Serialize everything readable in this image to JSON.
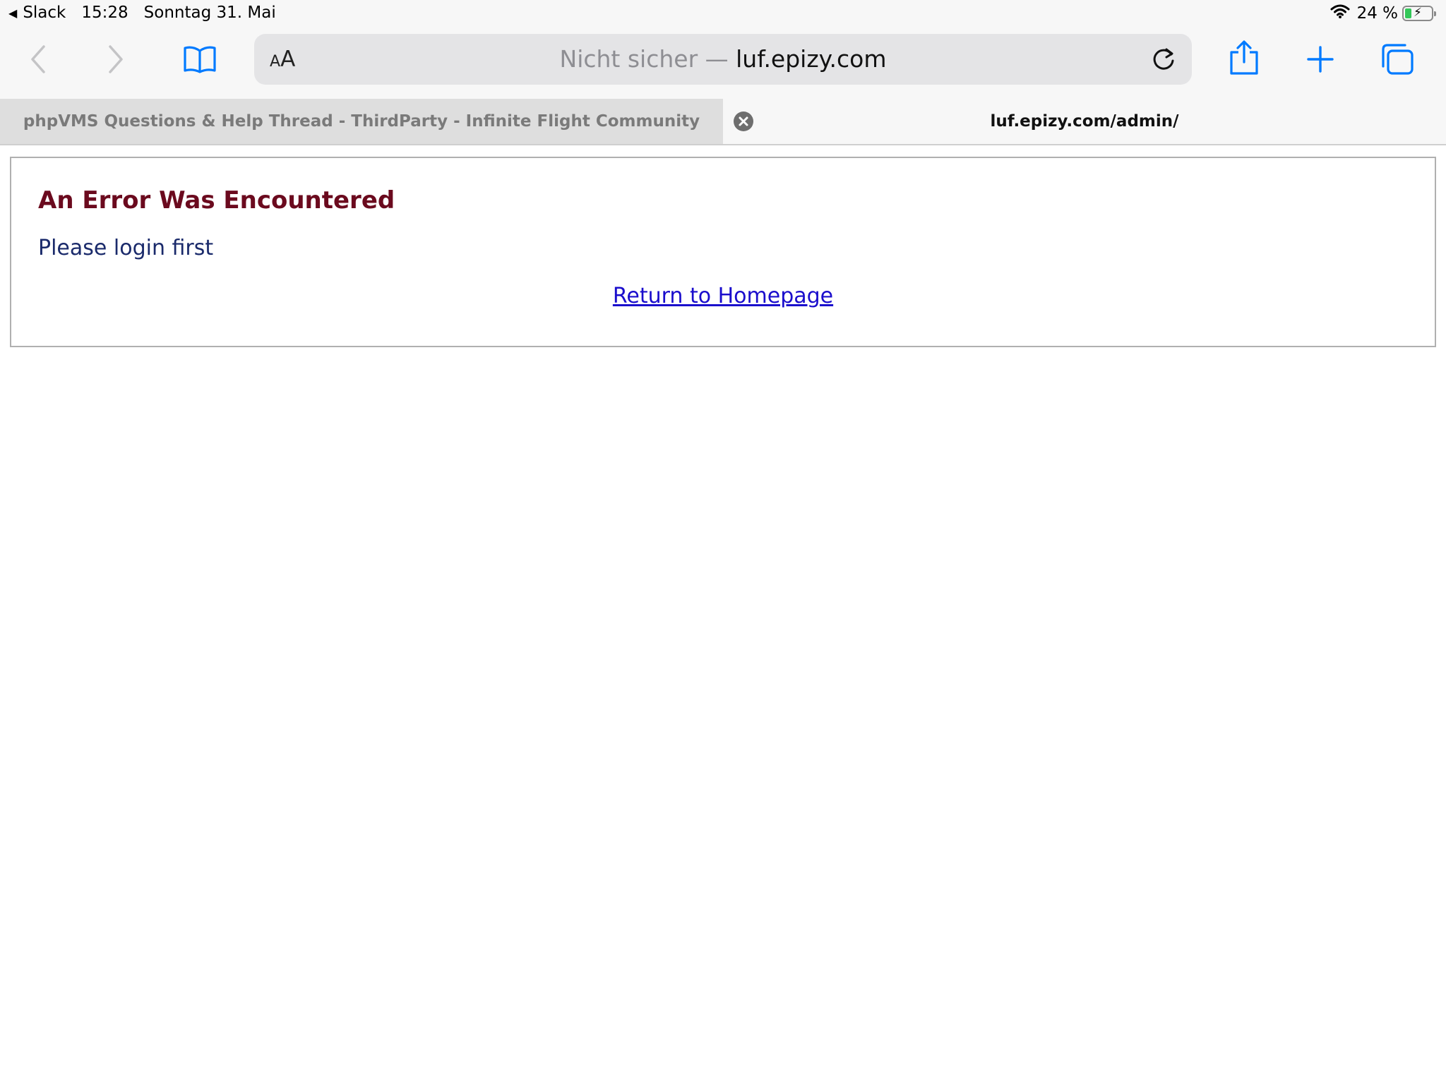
{
  "status_bar": {
    "back_app": "Slack",
    "time": "15:28",
    "date": "Sonntag 31. Mai",
    "battery_percent": "24 %",
    "battery_level": 0.24
  },
  "toolbar": {
    "reader_small": "A",
    "reader_big": "A",
    "url_insecure": "Nicht sicher —",
    "url_domain": "luf.epizy.com",
    "accent_color": "#007aff"
  },
  "tabs": [
    {
      "title": "phpVMS Questions & Help Thread - ThirdParty - Infinite Flight Community",
      "active": false
    },
    {
      "title": "luf.epizy.com/admin/",
      "active": true
    }
  ],
  "page": {
    "error_title": "An Error Was Encountered",
    "error_message": "Please login first",
    "return_link": "Return to Homepage"
  }
}
